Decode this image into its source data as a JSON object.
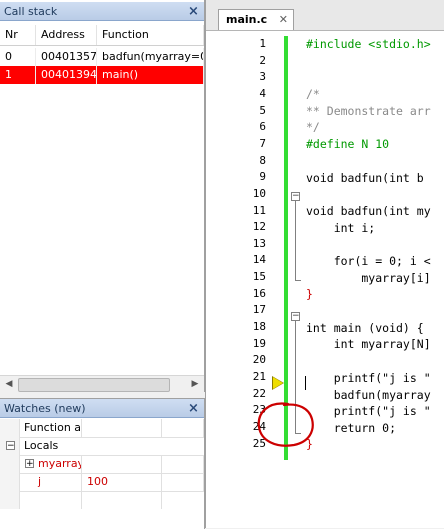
{
  "callstack": {
    "title": "Call stack",
    "columns": [
      "Nr",
      "Address",
      "Function"
    ],
    "rows": [
      {
        "nr": "0",
        "address": "00401357",
        "function": "badfun(myarray=0",
        "selected": false
      },
      {
        "nr": "1",
        "address": "00401394",
        "function": "main()",
        "selected": true
      }
    ]
  },
  "watches": {
    "title": "Watches (new)",
    "header_name": "Function arg",
    "locals_label": "Locals",
    "items": [
      {
        "name": "myarray",
        "value": ""
      },
      {
        "name": "j",
        "value": "100"
      }
    ]
  },
  "editor": {
    "tab_label": "main.c",
    "line_numbers": [
      "1",
      "2",
      "3",
      "4",
      "5",
      "6",
      "7",
      "8",
      "9",
      "10",
      "11",
      "12",
      "13",
      "14",
      "15",
      "16",
      "17",
      "18",
      "19",
      "20",
      "21",
      "22",
      "23",
      "24",
      "25"
    ],
    "lines": {
      "l1": "#include <stdio.h>",
      "l3": "/*",
      "l4": "** Demonstrate arr",
      "l5": "*/",
      "l6": "#define N 10",
      "l8": "void badfun(int b",
      "l10": "void badfun(int my",
      "l11": "    int i;",
      "l13": "    for(i = 0; i <",
      "l14": "        myarray[i]",
      "l15": "}",
      "l17": "int main (void) {",
      "l18": "    int myarray[N]",
      "l20": "    printf(\"j is \"",
      "l21": "    badfun(myarray",
      "l22": "    printf(\"j is \"",
      "l23": "    return 0;",
      "l24": "}"
    }
  },
  "colors": {
    "selection": "#ff0000",
    "change_bar": "#33dd33",
    "annotation": "#cc0000",
    "keyword": "#0000cc",
    "preprocessor": "#009900"
  }
}
